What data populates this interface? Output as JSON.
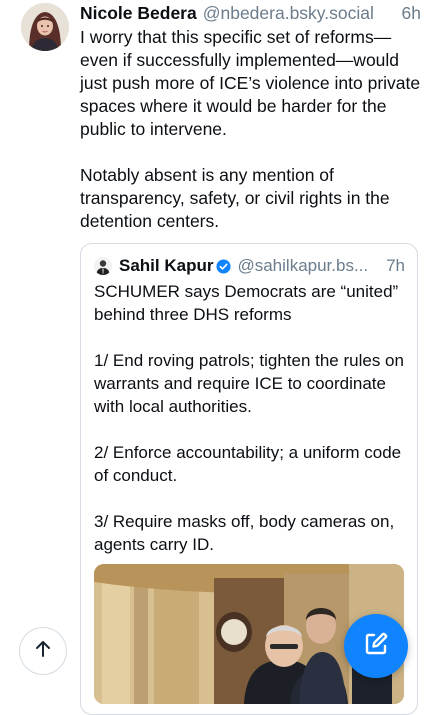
{
  "post": {
    "author_name": "Nicole Bedera",
    "author_handle": "@nbedera.bsky.social",
    "time": "6h",
    "text": "I worry that this specific set of reforms—even if successfully implemented—would just push more of ICE’s violence into private spaces where it would be harder for the public to intervene.\n\nNotably absent is any mention of transparency, safety, or civil rights in the detention centers."
  },
  "quote": {
    "author_name": "Sahil Kapur",
    "author_handle": "@sahilkapur.bs...",
    "time": "7h",
    "text": "SCHUMER says Democrats are “united” behind three DHS reforms\n\n1/ End roving patrols; tighten the rules on warrants and require ICE to coordinate with local authorities.\n\n2/ Enforce accountability; a uniform code of conduct.\n\n3/ Require masks off, body cameras on, agents carry ID."
  },
  "icons": {
    "verified": "verified-check-icon",
    "scroll_top": "arrow-up-icon",
    "compose": "compose-pencil-icon"
  },
  "colors": {
    "accent": "#1083fe",
    "handle": "#6b7c8c",
    "border": "#d4dbe2"
  }
}
